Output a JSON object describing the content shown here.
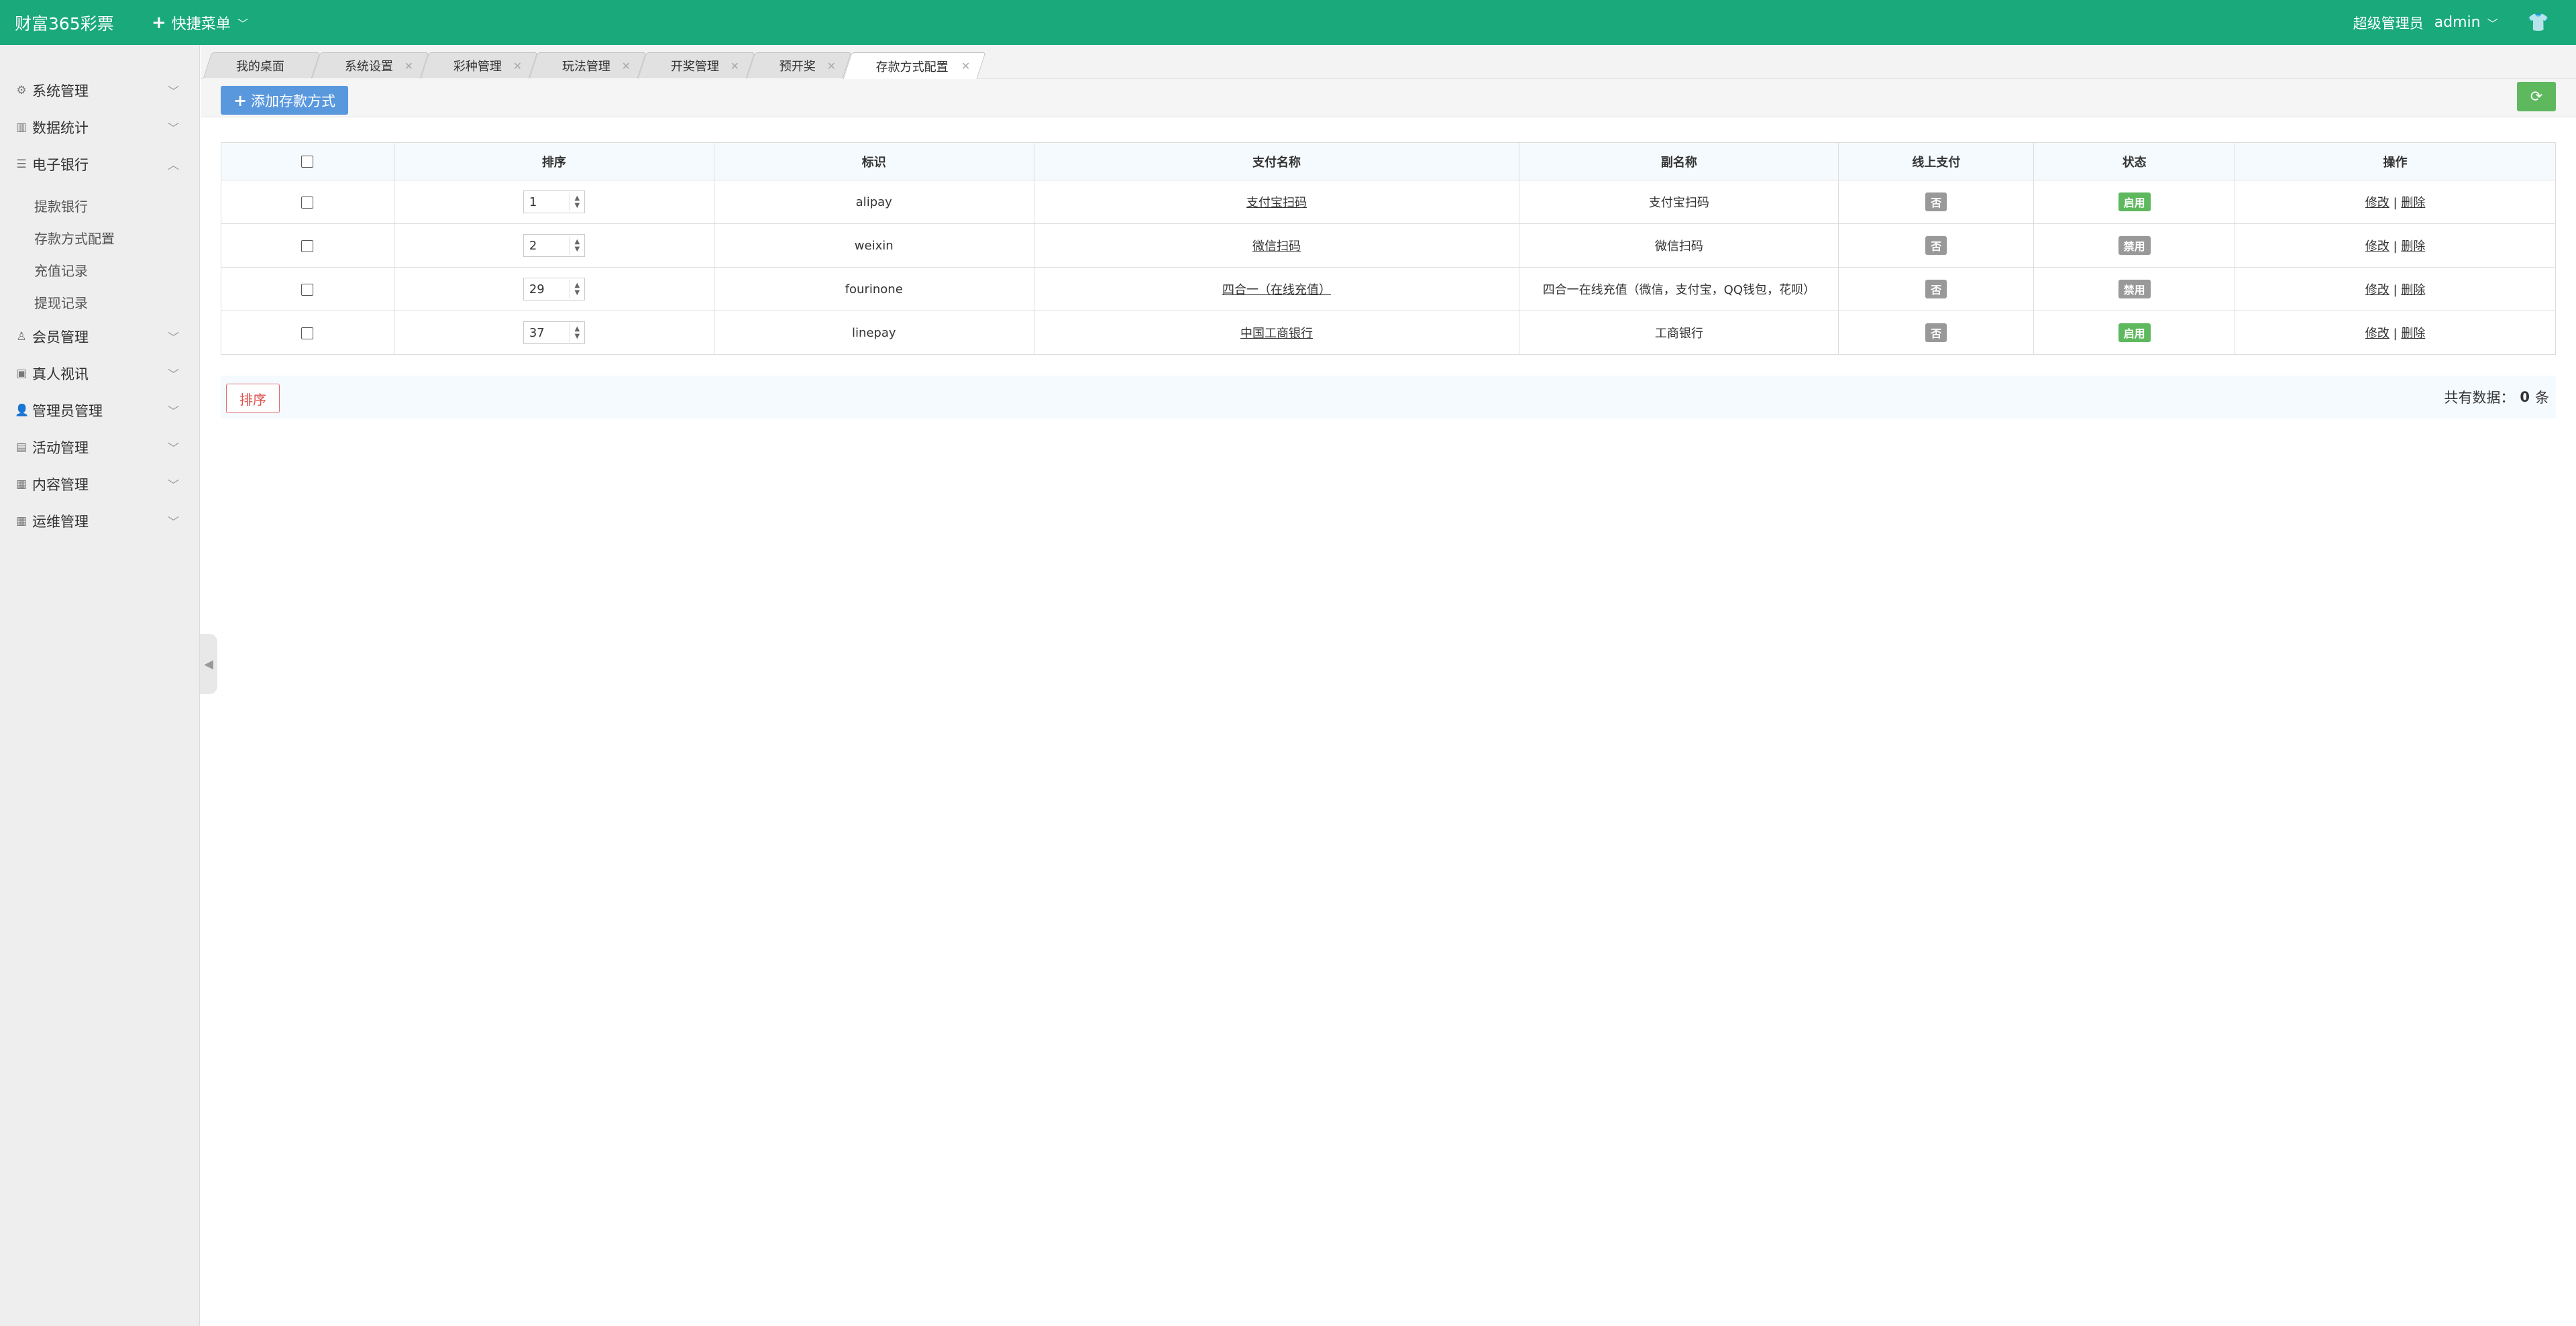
{
  "header": {
    "brand": "财富365彩票",
    "quick_menu": "快捷菜单",
    "role": "超级管理员",
    "user": "admin"
  },
  "sidebar": {
    "groups": [
      {
        "label": "系统管理",
        "icon": "gear-icon"
      },
      {
        "label": "数据统计",
        "icon": "chart-icon"
      },
      {
        "label": "电子银行",
        "icon": "list-icon",
        "expanded": true,
        "items": [
          "提款银行",
          "存款方式配置",
          "充值记录",
          "提现记录"
        ]
      },
      {
        "label": "会员管理",
        "icon": "user-icon"
      },
      {
        "label": "真人视讯",
        "icon": "video-icon"
      },
      {
        "label": "管理员管理",
        "icon": "admin-icon"
      },
      {
        "label": "活动管理",
        "icon": "gift-icon"
      },
      {
        "label": "内容管理",
        "icon": "content-icon"
      },
      {
        "label": "运维管理",
        "icon": "ops-icon"
      }
    ]
  },
  "tabs": [
    {
      "label": "我的桌面"
    },
    {
      "label": "系统设置"
    },
    {
      "label": "彩种管理"
    },
    {
      "label": "玩法管理"
    },
    {
      "label": "开奖管理"
    },
    {
      "label": "预开奖"
    },
    {
      "label": "存款方式配置",
      "active": true
    }
  ],
  "toolbar": {
    "add_label": "添加存款方式"
  },
  "table": {
    "headers": [
      "排序",
      "标识",
      "支付名称",
      "副名称",
      "线上支付",
      "状态",
      "操作"
    ],
    "rows": [
      {
        "order": "1",
        "code": "alipay",
        "name": "支付宝扫码",
        "subname": "支付宝扫码",
        "online": "否",
        "status": "启用",
        "status_color": "#5eb95e"
      },
      {
        "order": "2",
        "code": "weixin",
        "name": "微信扫码",
        "subname": "微信扫码",
        "online": "否",
        "status": "禁用",
        "status_color": "#999999"
      },
      {
        "order": "29",
        "code": "fourinone",
        "name": "四合一（在线充值）",
        "subname": "四合一在线充值（微信，支付宝，QQ钱包，花呗）",
        "online": "否",
        "status": "禁用",
        "status_color": "#999999"
      },
      {
        "order": "37",
        "code": "linepay",
        "name": "中国工商银行",
        "subname": "工商银行",
        "online": "否",
        "status": "启用",
        "status_color": "#5eb95e"
      }
    ],
    "edit_label": "修改",
    "delete_label": "删除",
    "separator": "|"
  },
  "footer": {
    "sort_label": "排序",
    "total_prefix": "共有数据：",
    "total_count": "0",
    "total_suffix": "条"
  },
  "colors": {
    "header_bg": "#19a97b",
    "primary_button": "#5a98de",
    "success": "#5eb95e",
    "danger": "#dd514c"
  }
}
